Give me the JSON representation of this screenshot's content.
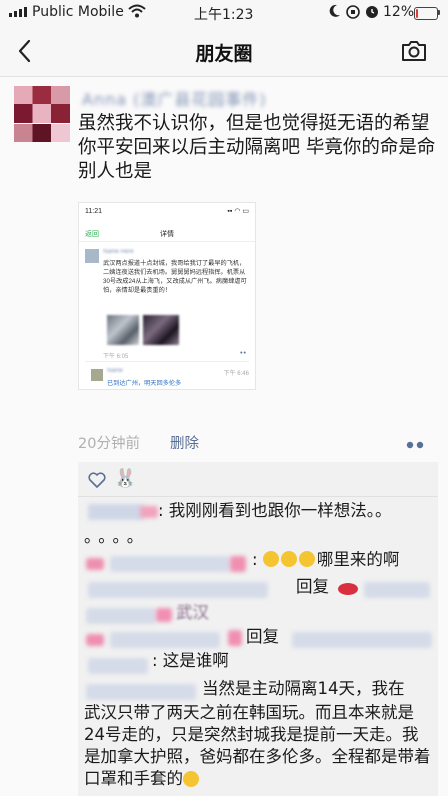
{
  "status_bar": {
    "carrier": "Public Mobile",
    "time": "上午1:23",
    "battery": "12%",
    "battery_level": 0.12,
    "icons": [
      "signal-icon",
      "wifi-icon",
      "moon-icon",
      "rotation-lock-icon",
      "alarm-icon",
      "battery-icon"
    ]
  },
  "nav": {
    "title": "朋友圈",
    "back_icon": "chevron-left-icon",
    "camera_icon": "camera-icon"
  },
  "post": {
    "author": "Anna (澳广县花园事件)",
    "text": "虽然我不认识你，但是也觉得挺无语的希望你平安回来以后主动隔离吧 毕竟你的命是命 别人也是",
    "screenshot": {
      "status_time": "11:21",
      "back": "返回",
      "title": "详情",
      "body": "武汉两点报道十点封城，我哥给我订了最早的飞机，二姨连夜送我们去机场。舅舅舅妈远程指挥。机票从30号改成24从上海飞，又改成从广州飞。病魔肆虐可怕，亲情却是最贵重的！",
      "time": "下午 6:05",
      "reply_time": "下午 6:46",
      "reply": "已到达广州，明天回多伦多"
    },
    "time_ago": "20分钟前",
    "delete_label": "删除",
    "more_icon": "more-dots-icon"
  },
  "likes": {
    "heart_icon": "heart-icon",
    "liker_icon": "bunny-avatar-icon"
  },
  "comments": [
    {
      "text": ": 我刚刚看到也跟你一样想法。。",
      "text2": "。。。。"
    },
    {
      "text": "哪里来的啊"
    },
    {
      "text": "回复"
    },
    {
      "text": "武汉"
    },
    {
      "text": "回复"
    },
    {
      "text": ": 这是谁啊"
    },
    {
      "text": "当然是主动隔离14天，我在"
    },
    {
      "text": "武汉只带了两天之前在韩国玩。而且本来就是24号走的，只是突然封城我是提前一天走。我是加拿大护照，爸妈都在多伦多。全程都是带着口罩和手套的"
    }
  ]
}
